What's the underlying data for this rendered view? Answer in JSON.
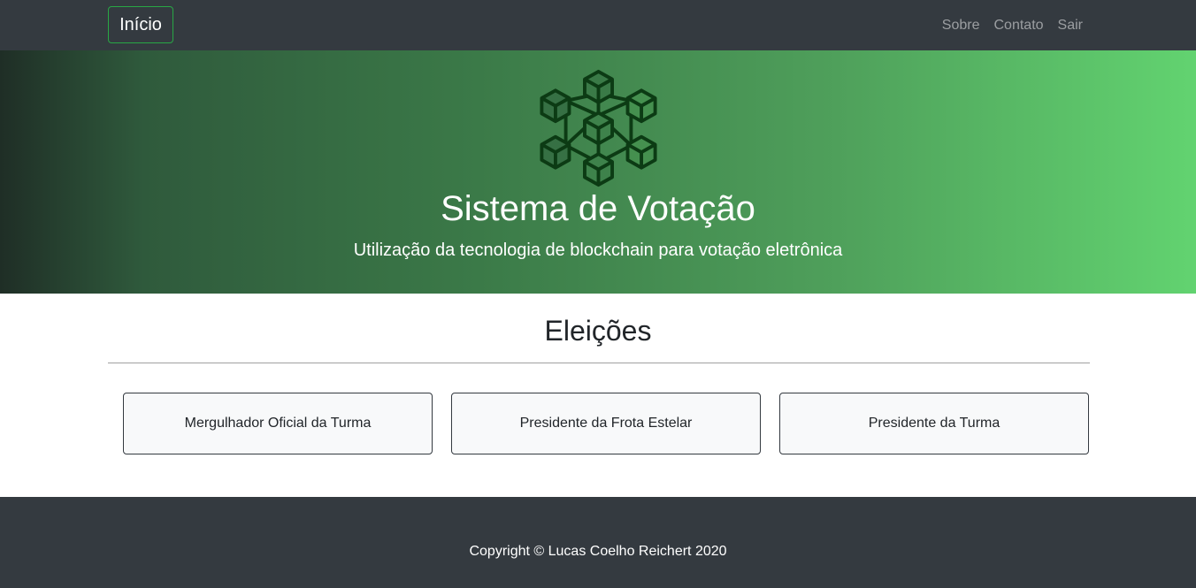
{
  "navbar": {
    "brand": "Início",
    "links": [
      "Sobre",
      "Contato",
      "Sair"
    ]
  },
  "hero": {
    "logo_icon": "blockchain-cubes-icon",
    "title": "Sistema de Votação",
    "subtitle": "Utilização da tecnologia de blockchain para votação eletrônica"
  },
  "elections": {
    "title": "Eleições",
    "items": [
      "Mergulhador Oficial da Turma",
      "Presidente da Frota Estelar",
      "Presidente da Turma"
    ]
  },
  "footer": {
    "text": "Copyright © Lucas Coelho Reichert 2020"
  },
  "colors": {
    "navbar": "#343a40",
    "brand_border": "#28a745",
    "hero_gradient_start": "#1f2e26",
    "hero_gradient_end": "#62d370",
    "logo_stroke": "#0c3b14",
    "card_bg": "#f8f9fa"
  }
}
